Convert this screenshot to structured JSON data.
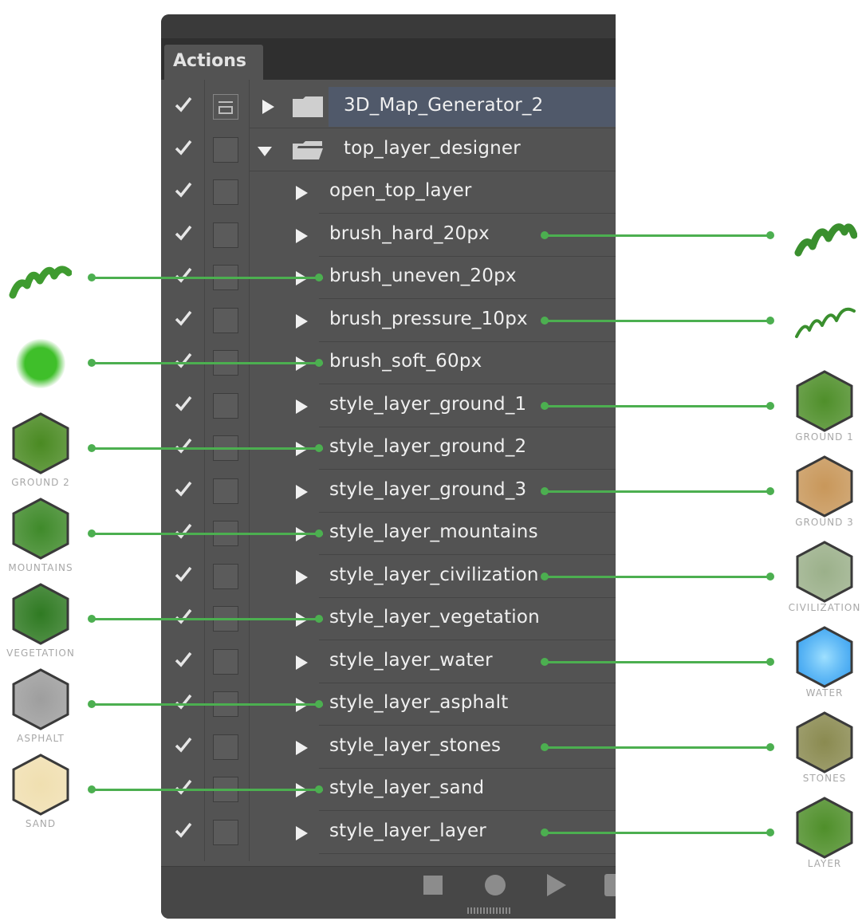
{
  "panel": {
    "tab_title": "Actions",
    "rows": [
      {
        "label": "3D_Map_Generator_2",
        "kind": "set",
        "expanded": false,
        "checked": true,
        "dialog": true,
        "selected": true
      },
      {
        "label": "top_layer_designer",
        "kind": "set",
        "expanded": true,
        "checked": true,
        "dialog": false,
        "selected": false
      },
      {
        "label": "open_top_layer",
        "kind": "action",
        "checked": true
      },
      {
        "label": "brush_hard_20px",
        "kind": "action",
        "checked": true
      },
      {
        "label": "brush_uneven_20px",
        "kind": "action",
        "checked": true
      },
      {
        "label": "brush_pressure_10px",
        "kind": "action",
        "checked": true
      },
      {
        "label": "brush_soft_60px",
        "kind": "action",
        "checked": true
      },
      {
        "label": "style_layer_ground_1",
        "kind": "action",
        "checked": true
      },
      {
        "label": "style_layer_ground_2",
        "kind": "action",
        "checked": true
      },
      {
        "label": "style_layer_ground_3",
        "kind": "action",
        "checked": true
      },
      {
        "label": "style_layer_mountains",
        "kind": "action",
        "checked": true
      },
      {
        "label": "style_layer_civilization",
        "kind": "action",
        "checked": true
      },
      {
        "label": "style_layer_vegetation",
        "kind": "action",
        "checked": true
      },
      {
        "label": "style_layer_water",
        "kind": "action",
        "checked": true
      },
      {
        "label": "style_layer_asphalt",
        "kind": "action",
        "checked": true
      },
      {
        "label": "style_layer_stones",
        "kind": "action",
        "checked": true
      },
      {
        "label": "style_layer_sand",
        "kind": "action",
        "checked": true
      },
      {
        "label": "style_layer_layer",
        "kind": "action",
        "checked": true
      }
    ],
    "bottom_buttons": [
      "stop-icon",
      "record-icon",
      "play-icon",
      "new-set-icon"
    ]
  },
  "swatches": {
    "left": [
      {
        "row": "brush_uneven_20px",
        "label": "",
        "kind": "brush-stroke",
        "color": "#3f9b30"
      },
      {
        "row": "brush_soft_60px",
        "label": "",
        "kind": "soft-dot",
        "color": "#3fbf2a"
      },
      {
        "row": "style_layer_ground_2",
        "label": "GROUND 2",
        "kind": "hex",
        "color": "#4a8a22"
      },
      {
        "row": "style_layer_mountains",
        "label": "MOUNTAINS",
        "kind": "hex",
        "color": "#3f8a2a"
      },
      {
        "row": "style_layer_vegetation",
        "label": "VEGETATION",
        "kind": "hex",
        "color": "#2f7a22"
      },
      {
        "row": "style_layer_asphalt",
        "label": "ASPHALT",
        "kind": "hex",
        "color": "#9e9e9e"
      },
      {
        "row": "style_layer_sand",
        "label": "SAND",
        "kind": "hex",
        "color": "#f0dfb0"
      }
    ],
    "right": [
      {
        "row": "brush_hard_20px",
        "label": "",
        "kind": "brush-stroke",
        "color": "#3a8f2e"
      },
      {
        "row": "brush_pressure_10px",
        "label": "",
        "kind": "brush-stroke-thin",
        "color": "#3a8f2e"
      },
      {
        "row": "style_layer_ground_1",
        "label": "GROUND 1",
        "kind": "hex",
        "color": "#4f8f2a"
      },
      {
        "row": "style_layer_ground_3",
        "label": "GROUND 3",
        "kind": "hex",
        "color": "#c8975a"
      },
      {
        "row": "style_layer_civilization",
        "label": "CIVILIZATION",
        "kind": "hex",
        "color": "#9bb08a"
      },
      {
        "row": "style_layer_water",
        "label": "WATER",
        "kind": "hex",
        "color": "#2a9cf0"
      },
      {
        "row": "style_layer_stones",
        "label": "STONES",
        "kind": "hex",
        "color": "#8a8a50"
      },
      {
        "row": "style_layer_layer",
        "label": "LAYER",
        "kind": "hex",
        "color": "#4f8f2a"
      }
    ]
  },
  "colors": {
    "panel_bg": "#535353",
    "selection": "#50596a",
    "callout_line": "#4caf50"
  }
}
